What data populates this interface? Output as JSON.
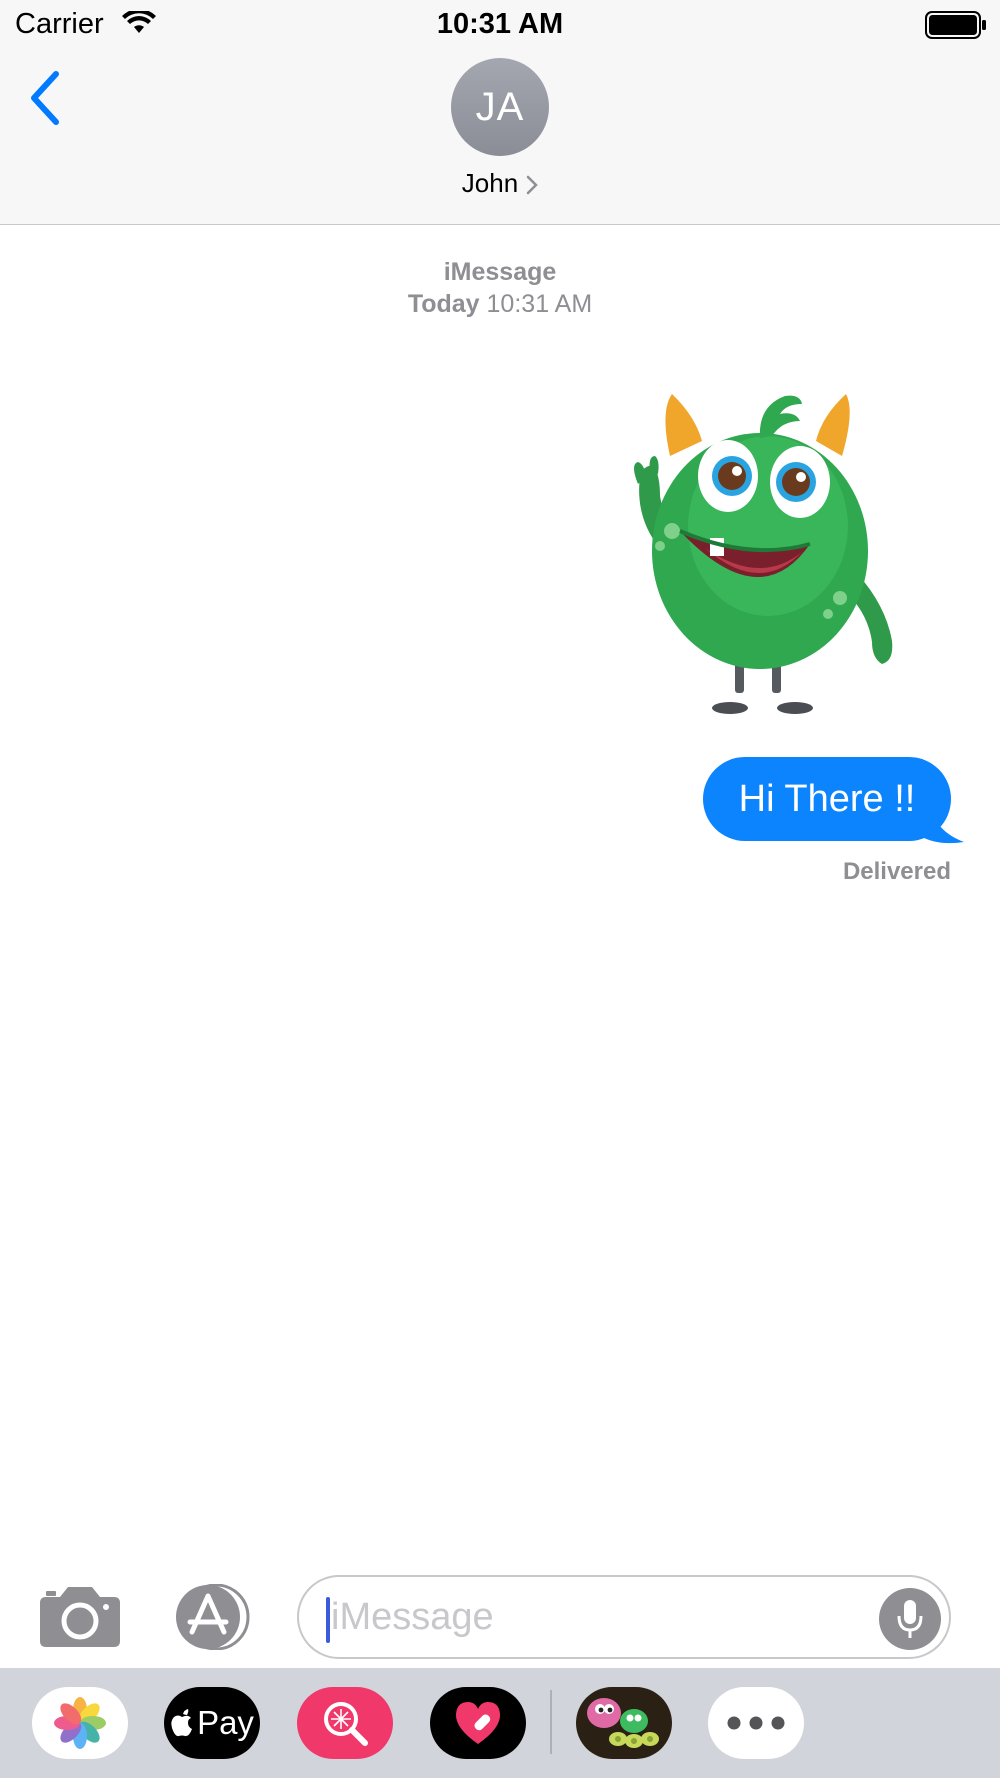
{
  "status_bar": {
    "carrier": "Carrier",
    "time": "10:31 AM"
  },
  "header": {
    "avatar_initials": "JA",
    "contact_name": "John"
  },
  "conversation": {
    "service_label": "iMessage",
    "day_label": "Today",
    "time_label": "10:31 AM",
    "sticker": "green-monster-sticker",
    "messages": [
      {
        "text": "Hi There !!",
        "sender": "me",
        "status": "Delivered"
      }
    ]
  },
  "composer": {
    "placeholder": "iMessage"
  },
  "app_drawer": {
    "apps": [
      {
        "name": "photos-app-icon"
      },
      {
        "name": "apple-pay-icon",
        "label": "Pay"
      },
      {
        "name": "search-app-icon"
      },
      {
        "name": "heart-app-icon"
      },
      {
        "name": "monster-sticker-app-icon"
      },
      {
        "name": "more-apps-icon"
      }
    ]
  },
  "colors": {
    "bubble": "#0b84fe",
    "accent": "#007aff",
    "header_bg": "#f7f7f7",
    "drawer_bg": "#d2d4db"
  }
}
